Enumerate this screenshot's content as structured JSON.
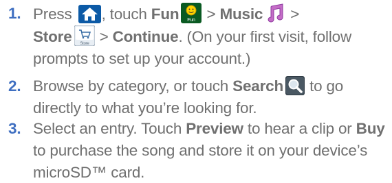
{
  "steps": [
    {
      "number": "1.",
      "parts": {
        "p1": "Press ",
        "p2": ", touch ",
        "fun": "Fun",
        "fun_icon_label": "Fun",
        "p3": " > ",
        "music": "Music",
        "p4": " >",
        "store": "Store",
        "store_icon_label": "Store",
        "p5": " > ",
        "continue": "Continue",
        "p6": ". (On your first visit, follow prompts to set up your account.)"
      }
    },
    {
      "number": "2.",
      "parts": {
        "p1": "Browse by category, or touch ",
        "search": "Search",
        "p2": " to go directly to what you’re looking for."
      }
    },
    {
      "number": "3.",
      "parts": {
        "p1": "Select an entry. Touch ",
        "preview": "Preview",
        "p2": " to hear a clip or ",
        "buy": "Buy",
        "p3": " to purchase the song and store it on your device’s microSD™ card."
      }
    }
  ],
  "icons": {
    "home": "home-icon",
    "fun": "fun-icon",
    "music": "music-note-icon",
    "store": "store-cart-icon",
    "search": "search-magnifier-icon"
  }
}
